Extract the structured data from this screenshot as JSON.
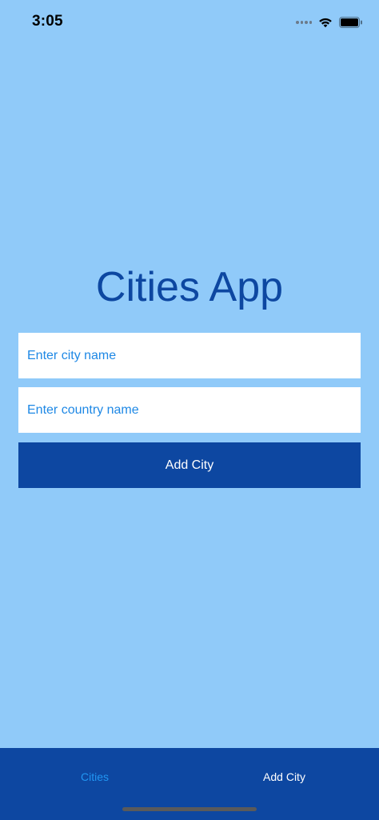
{
  "status_bar": {
    "time": "3:05",
    "icons": [
      "signal-icon",
      "wifi-icon",
      "battery-icon"
    ]
  },
  "main": {
    "title": "Cities App",
    "city_input": {
      "placeholder": "Enter city name",
      "value": ""
    },
    "country_input": {
      "placeholder": "Enter country name",
      "value": ""
    },
    "add_button_label": "Add City"
  },
  "tab_bar": {
    "tabs": [
      {
        "label": "Cities",
        "active": true
      },
      {
        "label": "Add City",
        "active": false
      }
    ]
  },
  "colors": {
    "background": "#90caf9",
    "primary": "#0d47a1",
    "accent": "#2196f3",
    "input_text": "#1e88e5",
    "white": "#ffffff"
  }
}
